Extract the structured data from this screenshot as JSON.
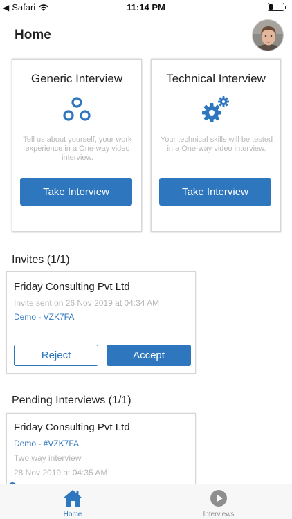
{
  "status_bar": {
    "carrier": "Safari",
    "time": "11:14 PM",
    "battery_level": 0.25
  },
  "header": {
    "title": "Home"
  },
  "cards": [
    {
      "title": "Generic Interview",
      "icon": "three-circles-icon",
      "description": "Tell us about yourself, your work experience in a One-way video interview.",
      "button_label": "Take Interview"
    },
    {
      "title": "Technical Interview",
      "icon": "gears-icon",
      "description": "Your technical skills will be tested in a One-way video interview.",
      "button_label": "Take Interview"
    }
  ],
  "invites": {
    "title": "Invites (1/1)",
    "items": [
      {
        "company": "Friday Consulting Pvt Ltd",
        "sent": "Invite sent on 26 Nov 2019 at 04:34 AM",
        "code": "Demo - VZK7FA",
        "reject_label": "Reject",
        "accept_label": "Accept"
      }
    ]
  },
  "pending": {
    "title": "Pending Interviews (1/1)",
    "items": [
      {
        "company": "Friday Consulting Pvt Ltd",
        "code": "Demo - #VZK7FA",
        "type": "Two way interview",
        "date": "28 Nov 2019 at 04:35 AM"
      }
    ]
  },
  "tab_bar": {
    "tabs": [
      {
        "label": "Home",
        "icon": "home-icon",
        "active": true
      },
      {
        "label": "Interviews",
        "icon": "play-circle-icon",
        "active": false
      }
    ]
  },
  "colors": {
    "accent": "#2e77be",
    "muted_text": "#b5b5b5",
    "inactive_tab": "#8e8e8e"
  }
}
